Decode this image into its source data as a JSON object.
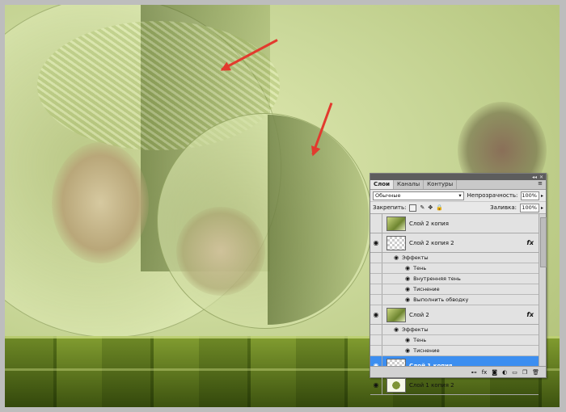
{
  "panel": {
    "tabs": [
      "Слои",
      "Каналы",
      "Контуры"
    ],
    "blend_mode": "Обычные",
    "opacity_label": "Непрозрачность:",
    "opacity_value": "100%",
    "lock_label": "Закрепить:",
    "fill_label": "Заливка:",
    "fill_value": "100%"
  },
  "layers": [
    {
      "name": "Слой 2 копия",
      "visible": false,
      "thumb": "pic",
      "fx": false,
      "effects": []
    },
    {
      "name": "Слой 2 копия 2",
      "visible": true,
      "thumb": "check",
      "fx": true,
      "effects_label": "Эффекты",
      "effects": [
        "Тень",
        "Внутренняя тень",
        "Тиснение",
        "Выполнить обводку"
      ]
    },
    {
      "name": "Слой 2",
      "visible": true,
      "thumb": "pic",
      "fx": true,
      "effects_label": "Эффекты",
      "effects": [
        "Тень",
        "Тиснение"
      ]
    },
    {
      "name": "Слой 1 копия",
      "visible": true,
      "thumb": "check",
      "fx": false,
      "selected": true,
      "effects": []
    },
    {
      "name": "Слой 1 копия 2",
      "visible": true,
      "thumb": "pic2",
      "fx": false,
      "effects": []
    }
  ],
  "fx_symbol": "fx",
  "colors": {
    "accent": "#3c8ef0",
    "arrow": "#e23a2e"
  }
}
